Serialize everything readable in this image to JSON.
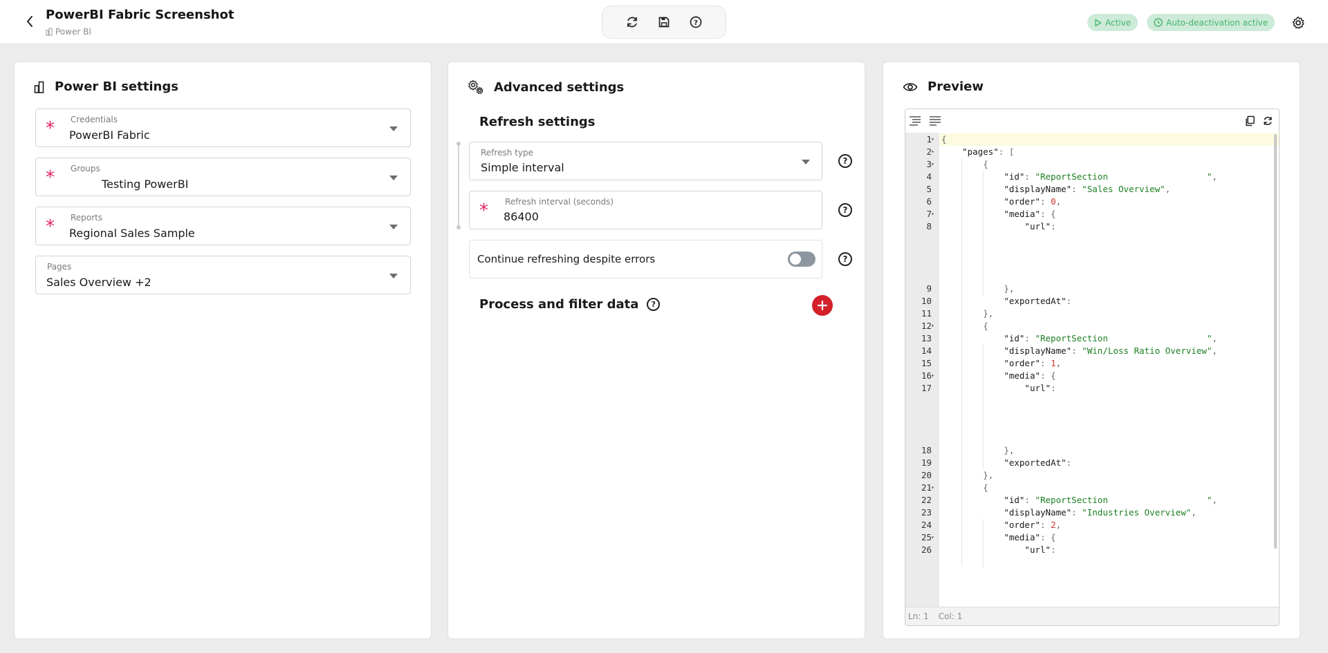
{
  "header": {
    "title": "PowerBI Fabric Screenshot",
    "subtitle": "Power BI",
    "badges": {
      "active": "Active",
      "auto_deactivation": "Auto-deactivation active"
    }
  },
  "power_bi_settings": {
    "title": "Power BI settings",
    "fields": [
      {
        "label": "Credentials",
        "value": "PowerBI Fabric",
        "required": true
      },
      {
        "label": "Groups",
        "value": "Testing PowerBI",
        "required": true
      },
      {
        "label": "Reports",
        "value": "Regional Sales Sample",
        "required": true
      },
      {
        "label": "Pages",
        "value": "Sales Overview +2",
        "required": false
      }
    ]
  },
  "advanced_settings": {
    "title": "Advanced settings",
    "refresh_settings_title": "Refresh settings",
    "refresh_type": {
      "label": "Refresh type",
      "value": "Simple interval"
    },
    "refresh_interval": {
      "label": "Refresh interval (seconds)",
      "value": "86400"
    },
    "continue_refreshing_label": "Continue refreshing despite errors",
    "continue_refreshing_on": false,
    "process_filter_title": "Process and filter data"
  },
  "preview": {
    "title": "Preview",
    "status": {
      "ln": "Ln: 1",
      "col": "Col: 1"
    },
    "code_lines": [
      {
        "n": "1",
        "fold": true,
        "html": "<span class='p'>{</span>"
      },
      {
        "n": "2",
        "fold": true,
        "html": "    <span class='k'>\"pages\"</span><span class='p'>: [</span>"
      },
      {
        "n": "3",
        "fold": true,
        "html": "        <span class='p'>{</span>"
      },
      {
        "n": "4",
        "fold": false,
        "html": "            <span class='k'>\"id\"</span><span class='p'>: </span><span class='s'>\"ReportSection                   \"</span><span class='p'>,</span>"
      },
      {
        "n": "5",
        "fold": false,
        "html": "            <span class='k'>\"displayName\"</span><span class='p'>: </span><span class='s'>\"Sales Overview\"</span><span class='p'>,</span>"
      },
      {
        "n": "6",
        "fold": false,
        "html": "            <span class='k'>\"order\"</span><span class='p'>: </span><span class='n'>0</span><span class='p'>,</span>"
      },
      {
        "n": "7",
        "fold": true,
        "html": "            <span class='k'>\"media\"</span><span class='p'>: {</span>"
      },
      {
        "n": "8",
        "fold": false,
        "html": "                <span class='k'>\"url\"</span><span class='p'>:</span>"
      },
      {
        "n": "9",
        "fold": false,
        "html": "            <span class='p'>},</span>"
      },
      {
        "n": "10",
        "fold": false,
        "html": "            <span class='k'>\"exportedAt\"</span><span class='p'>:</span>"
      },
      {
        "n": "11",
        "fold": false,
        "html": "        <span class='p'>},</span>"
      },
      {
        "n": "12",
        "fold": true,
        "html": "        <span class='p'>{</span>"
      },
      {
        "n": "13",
        "fold": false,
        "html": "            <span class='k'>\"id\"</span><span class='p'>: </span><span class='s'>\"ReportSection                   \"</span><span class='p'>,</span>"
      },
      {
        "n": "14",
        "fold": false,
        "html": "            <span class='k'>\"displayName\"</span><span class='p'>: </span><span class='s'>\"Win/Loss Ratio Overview\"</span><span class='p'>,</span>"
      },
      {
        "n": "15",
        "fold": false,
        "html": "            <span class='k'>\"order\"</span><span class='p'>: </span><span class='n'>1</span><span class='p'>,</span>"
      },
      {
        "n": "16",
        "fold": true,
        "html": "            <span class='k'>\"media\"</span><span class='p'>: {</span>"
      },
      {
        "n": "17",
        "fold": false,
        "html": "                <span class='k'>\"url\"</span><span class='p'>:</span>"
      },
      {
        "n": "18",
        "fold": false,
        "html": "            <span class='p'>},</span>"
      },
      {
        "n": "19",
        "fold": false,
        "html": "            <span class='k'>\"exportedAt\"</span><span class='p'>:</span>"
      },
      {
        "n": "20",
        "fold": false,
        "html": "        <span class='p'>},</span>"
      },
      {
        "n": "21",
        "fold": true,
        "html": "        <span class='p'>{</span>"
      },
      {
        "n": "22",
        "fold": false,
        "html": "            <span class='k'>\"id\"</span><span class='p'>: </span><span class='s'>\"ReportSection                   \"</span><span class='p'>,</span>"
      },
      {
        "n": "23",
        "fold": false,
        "html": "            <span class='k'>\"displayName\"</span><span class='p'>: </span><span class='s'>\"Industries Overview\"</span><span class='p'>,</span>"
      },
      {
        "n": "24",
        "fold": false,
        "html": "            <span class='k'>\"order\"</span><span class='p'>: </span><span class='n'>2</span><span class='p'>,</span>"
      },
      {
        "n": "25",
        "fold": true,
        "html": "            <span class='k'>\"media\"</span><span class='p'>: {</span>"
      },
      {
        "n": "26",
        "fold": false,
        "html": "                <span class='k'>\"url\"</span><span class='p'>:</span>"
      }
    ]
  },
  "colors": {
    "accent_red": "#d3202b",
    "required_star": "#e0245e",
    "badge_green_bg": "#cdebd8",
    "badge_green_text": "#46b36b"
  }
}
